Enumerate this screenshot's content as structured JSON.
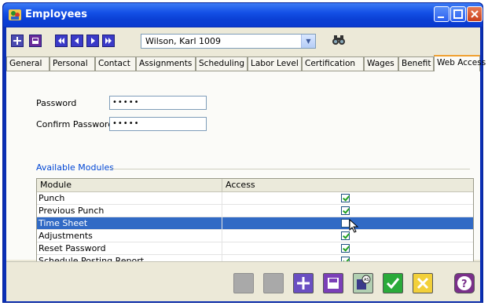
{
  "window": {
    "title": "Employees"
  },
  "toolbar": {
    "employee_value": "Wilson, Karl 1009"
  },
  "tabs": [
    {
      "label": "General"
    },
    {
      "label": "Personal"
    },
    {
      "label": "Contact"
    },
    {
      "label": "Assignments"
    },
    {
      "label": "Scheduling"
    },
    {
      "label": "Labor Level"
    },
    {
      "label": "Certification"
    },
    {
      "label": "Wages"
    },
    {
      "label": "Benefit"
    },
    {
      "label": "Web Access"
    }
  ],
  "active_tab": "Web Access",
  "form": {
    "password_label": "Password",
    "password_value": "•••••",
    "confirm_label": "Confirm Password",
    "confirm_value": "•••••",
    "modules_group": "Available Modules"
  },
  "grid": {
    "headers": {
      "module": "Module",
      "access": "Access"
    },
    "rows": [
      {
        "module": "Punch",
        "access": true
      },
      {
        "module": "Previous Punch",
        "access": true
      },
      {
        "module": "Time Sheet",
        "access": false,
        "selected": true
      },
      {
        "module": "Adjustments",
        "access": true
      },
      {
        "module": "Reset Password",
        "access": true
      },
      {
        "module": "Schedule Posting Report",
        "access": true
      }
    ]
  },
  "icons": [
    "employees-app-icon",
    "add-icon",
    "save-icon",
    "first-record-icon",
    "previous-record-icon",
    "next-record-icon",
    "last-record-icon",
    "binoculars-icon",
    "mouse-cursor-icon",
    "help-icon",
    "save-as-icon",
    "ok-check-icon",
    "cancel-x-icon"
  ],
  "colors": {
    "selection": "#316ac5",
    "title_bar": "#0b3fd4",
    "group_label": "#0046d5"
  }
}
